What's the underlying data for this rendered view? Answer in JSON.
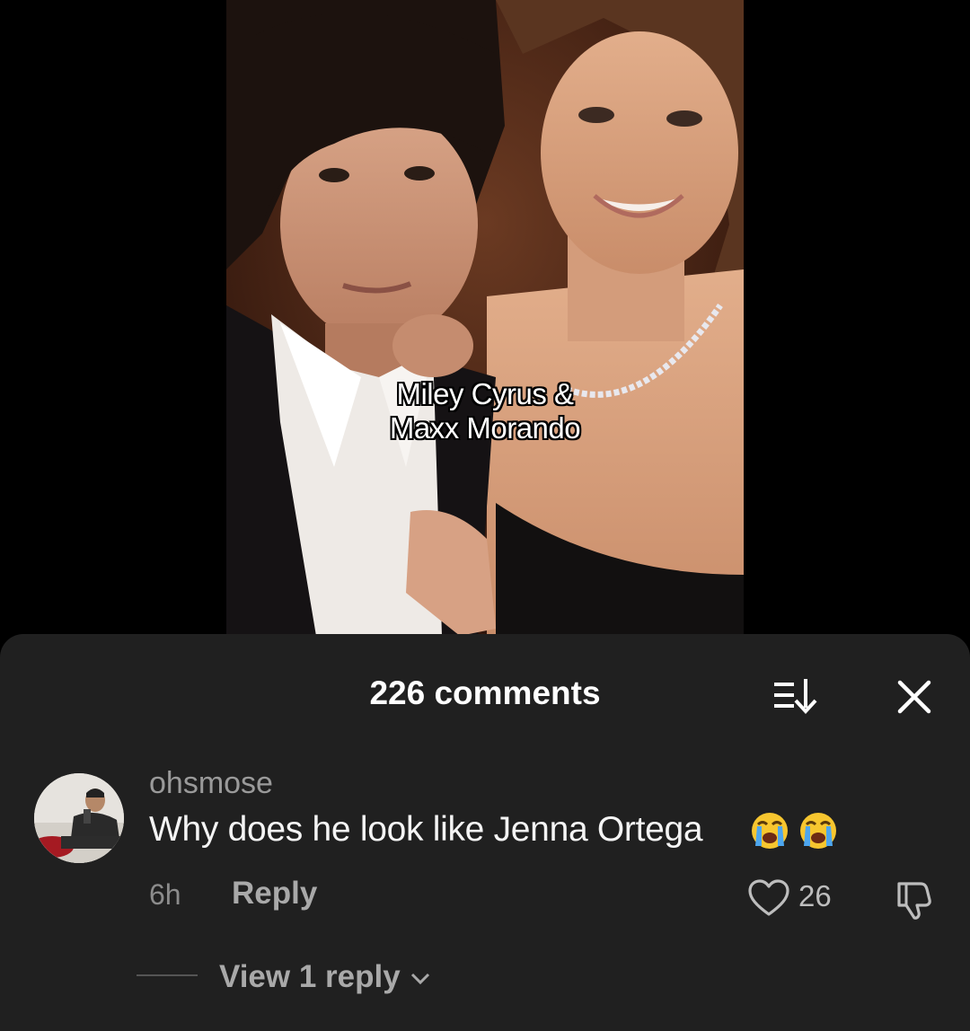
{
  "video": {
    "caption_line1": "Miley Cyrus &",
    "caption_line2": "Maxx Morando"
  },
  "comments_panel": {
    "title": "226 comments",
    "sort_icon": "sort-icon",
    "close_icon": "close-icon",
    "comment": {
      "username": "ohsmose",
      "text": "Why does he look like Jenna Ortega",
      "emojis": [
        "loudly-crying-face",
        "loudly-crying-face"
      ],
      "time": "6h",
      "reply_label": "Reply",
      "like_count": "26",
      "view_replies_label": "View 1 reply"
    }
  },
  "colors": {
    "sheet_background": "#202020",
    "page_background": "#000000",
    "username": "#9a9a9a",
    "secondary_text": "#a9a9a9"
  }
}
